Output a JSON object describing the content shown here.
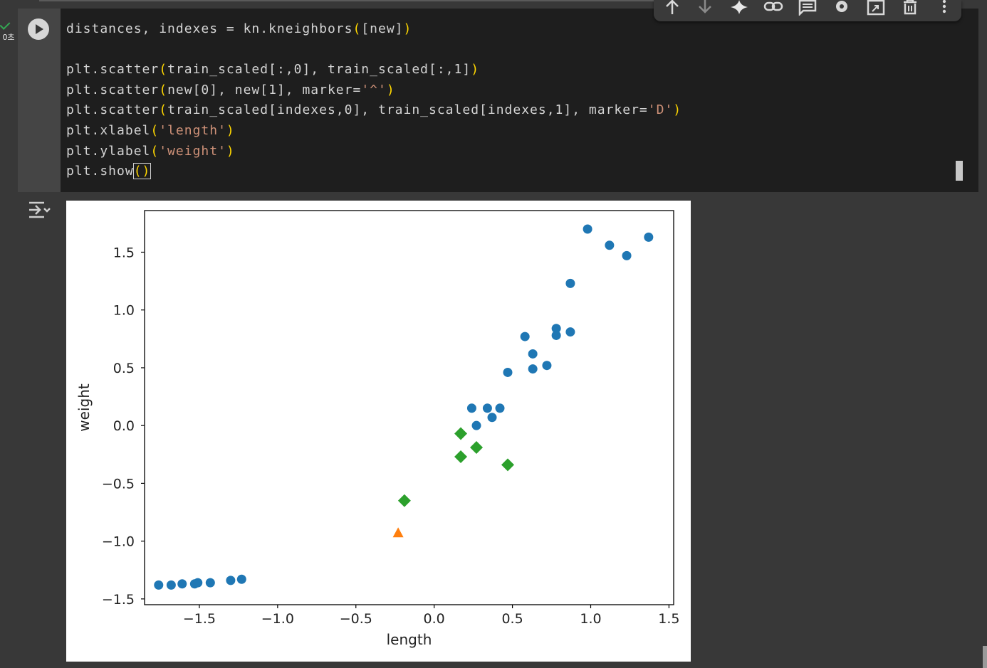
{
  "cell": {
    "exec_status": "0초",
    "code_lines": [
      [
        {
          "t": "distances, indexes = kn.kneighbors"
        },
        {
          "t": "(",
          "c": "br"
        },
        {
          "t": "[new]"
        },
        {
          "t": ")",
          "c": "br"
        }
      ],
      [],
      [
        {
          "t": "plt.scatter"
        },
        {
          "t": "(",
          "c": "br"
        },
        {
          "t": "train_scaled[:,0], train_scaled[:,1]"
        },
        {
          "t": ")",
          "c": "br"
        }
      ],
      [
        {
          "t": "plt.scatter"
        },
        {
          "t": "(",
          "c": "br"
        },
        {
          "t": "new[0], new[1], marker="
        },
        {
          "t": "'^'",
          "c": "str"
        },
        {
          "t": ")",
          "c": "br"
        }
      ],
      [
        {
          "t": "plt.scatter"
        },
        {
          "t": "(",
          "c": "br"
        },
        {
          "t": "train_scaled[indexes,0], train_scaled[indexes,1], marker="
        },
        {
          "t": "'D'",
          "c": "str"
        },
        {
          "t": ")",
          "c": "br"
        }
      ],
      [
        {
          "t": "plt.xlabel"
        },
        {
          "t": "(",
          "c": "br"
        },
        {
          "t": "'length'",
          "c": "str"
        },
        {
          "t": ")",
          "c": "br"
        }
      ],
      [
        {
          "t": "plt.ylabel"
        },
        {
          "t": "(",
          "c": "br"
        },
        {
          "t": "'weight'",
          "c": "str"
        },
        {
          "t": ")",
          "c": "br"
        }
      ],
      [
        {
          "t": "plt.show"
        },
        {
          "t": "()",
          "c": "br",
          "box": true
        }
      ]
    ]
  },
  "toolbar": {
    "icons": [
      "move-up-icon",
      "move-down-icon",
      "gemini-sparkle-icon",
      "link-icon",
      "comment-icon",
      "settings-gear-icon",
      "mirror-cell-icon",
      "delete-trash-icon",
      "more-vert-icon"
    ]
  },
  "output": {
    "icon": "output-options-icon"
  },
  "chart_data": {
    "type": "scatter",
    "xlabel": "length",
    "ylabel": "weight",
    "xlim": [
      -1.85,
      1.53
    ],
    "ylim": [
      -1.55,
      1.86
    ],
    "xticks": [
      -1.5,
      -1.0,
      -0.5,
      0.0,
      0.5,
      1.0,
      1.5
    ],
    "xtick_labels": [
      "−1.5",
      "−1.0",
      "−0.5",
      "0.0",
      "0.5",
      "1.0",
      "1.5"
    ],
    "yticks": [
      -1.5,
      -1.0,
      -0.5,
      0.0,
      0.5,
      1.0,
      1.5
    ],
    "ytick_labels": [
      "−1.5",
      "−1.0",
      "−0.5",
      "0.0",
      "0.5",
      "1.0",
      "1.5"
    ],
    "grid": false,
    "series": [
      {
        "marker": "circle",
        "color": "#1f77b4",
        "points": [
          [
            -1.76,
            -1.38
          ],
          [
            -1.68,
            -1.38
          ],
          [
            -1.61,
            -1.37
          ],
          [
            -1.53,
            -1.37
          ],
          [
            -1.51,
            -1.36
          ],
          [
            -1.43,
            -1.36
          ],
          [
            -1.3,
            -1.34
          ],
          [
            -1.23,
            -1.33
          ],
          [
            0.24,
            0.15
          ],
          [
            0.27,
            0.0
          ],
          [
            0.34,
            0.15
          ],
          [
            0.37,
            0.07
          ],
          [
            0.42,
            0.15
          ],
          [
            0.47,
            0.46
          ],
          [
            0.58,
            0.77
          ],
          [
            0.63,
            0.62
          ],
          [
            0.63,
            0.49
          ],
          [
            0.72,
            0.52
          ],
          [
            0.78,
            0.84
          ],
          [
            0.78,
            0.78
          ],
          [
            0.87,
            0.81
          ],
          [
            0.87,
            1.23
          ],
          [
            0.98,
            1.7
          ],
          [
            1.12,
            1.56
          ],
          [
            1.23,
            1.47
          ],
          [
            1.37,
            1.63
          ]
        ]
      },
      {
        "marker": "triangle",
        "color": "#ff7f0e",
        "points": [
          [
            -0.23,
            -0.93
          ]
        ]
      },
      {
        "marker": "diamond",
        "color": "#2ca02c",
        "points": [
          [
            -0.19,
            -0.65
          ],
          [
            0.17,
            -0.07
          ],
          [
            0.17,
            -0.27
          ],
          [
            0.27,
            -0.19
          ],
          [
            0.47,
            -0.34
          ]
        ]
      }
    ]
  }
}
